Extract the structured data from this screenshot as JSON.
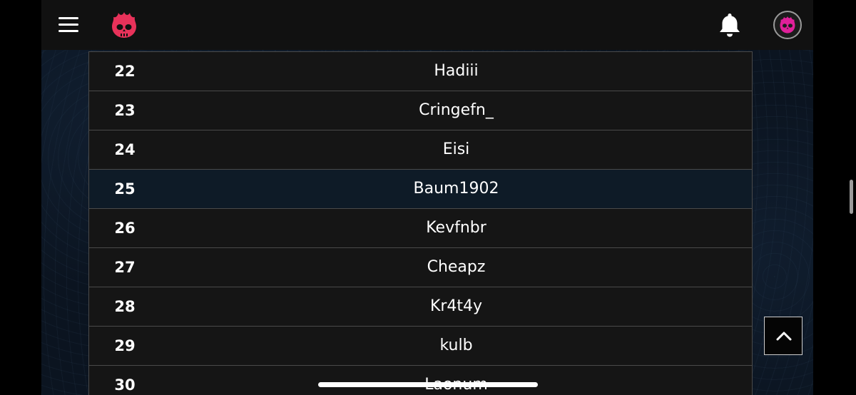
{
  "header": {
    "menu_icon": "hamburger-menu-icon",
    "logo_icon": "flaming-skull-logo",
    "notification_icon": "bell-icon",
    "avatar_icon": "skull-avatar",
    "brand_color": "#e8325a",
    "avatar_color": "#e0209a"
  },
  "leaderboard": {
    "rows": [
      {
        "rank": "22",
        "name": "Hadiii",
        "highlighted": false
      },
      {
        "rank": "23",
        "name": "Cringefn_",
        "highlighted": false
      },
      {
        "rank": "24",
        "name": "Eisi",
        "highlighted": false
      },
      {
        "rank": "25",
        "name": "Baum1902",
        "highlighted": true
      },
      {
        "rank": "26",
        "name": "Kevfnbr",
        "highlighted": false
      },
      {
        "rank": "27",
        "name": "Cheapz",
        "highlighted": false
      },
      {
        "rank": "28",
        "name": "Kr4t4y",
        "highlighted": false
      },
      {
        "rank": "29",
        "name": "kulb",
        "highlighted": false
      },
      {
        "rank": "30",
        "name": "Laonum",
        "highlighted": false
      }
    ]
  },
  "controls": {
    "scroll_top_icon": "chevron-up-icon"
  },
  "colors": {
    "row_background": "#151515",
    "row_highlight": "#0e1b27",
    "row_border": "#4a4a4a",
    "text": "#ffffff"
  }
}
